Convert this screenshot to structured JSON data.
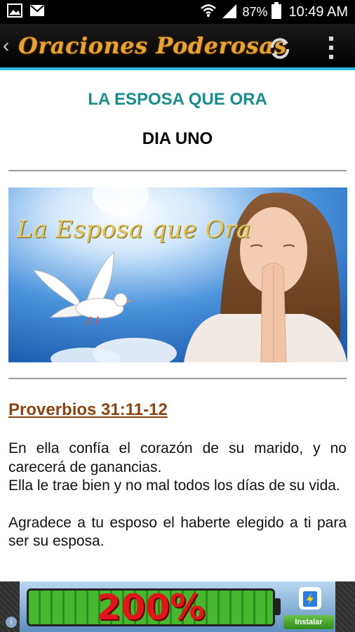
{
  "status_bar": {
    "battery": "87%",
    "time": "10:49 AM"
  },
  "app_bar": {
    "title": "Oraciones Poderosas"
  },
  "article": {
    "title": "LA ESPOSA QUE ORA",
    "subtitle": "DIA UNO",
    "image_caption": "La Esposa que Ora",
    "verse_ref": "Proverbios 31:11-12",
    "paragraphs": [
      "En ella confía el corazón de su marido, y no carecerá de ganancias.\nElla le trae bien y no mal todos los días de su vida.",
      "Agradece a tu esposo el haberte elegido a ti para ser su esposa."
    ]
  },
  "ad": {
    "headline": "200%",
    "button_label": "Instalar ahora",
    "info": "i"
  },
  "colors": {
    "title_teal": "#1a8c8c",
    "verse_brown": "#8b4513",
    "accent_blue": "#33b5e5",
    "app_title_gold": "#e6a233"
  }
}
